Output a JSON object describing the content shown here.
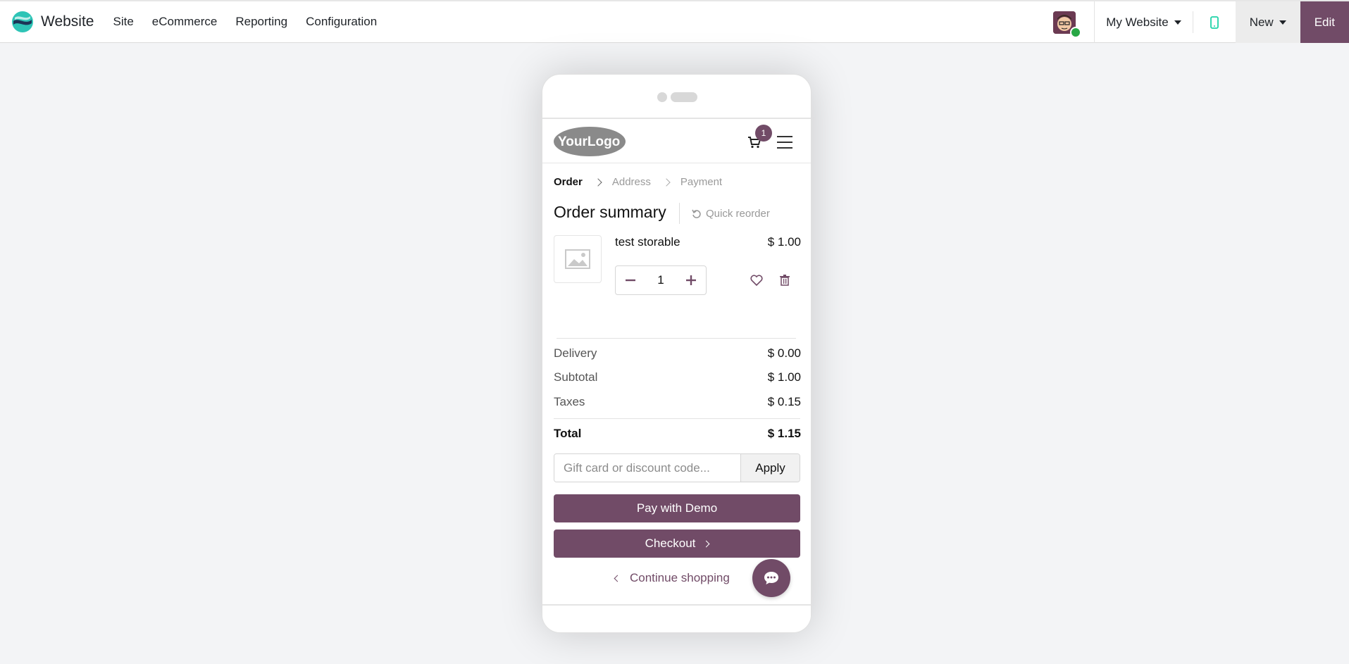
{
  "app": {
    "name": "Website",
    "menu": [
      "Site",
      "eCommerce",
      "Reporting",
      "Configuration"
    ],
    "website_selector": "My Website",
    "new_label": "New",
    "edit_label": "Edit"
  },
  "colors": {
    "brand": "#714b67",
    "mobile_icon": "#1fd3a8",
    "status_online": "#28a745"
  },
  "shop": {
    "logo_text": "YourLogo",
    "cart_count": "1",
    "steps": [
      {
        "label": "Order",
        "active": true
      },
      {
        "label": "Address",
        "active": false
      },
      {
        "label": "Payment",
        "active": false
      }
    ],
    "summary_title": "Order summary",
    "quick_reorder": "Quick reorder",
    "line": {
      "product": "test storable",
      "price": "$ 1.00",
      "quantity": "1"
    },
    "totals": {
      "delivery_label": "Delivery",
      "delivery_value": "$ 0.00",
      "subtotal_label": "Subtotal",
      "subtotal_value": "$ 1.00",
      "taxes_label": "Taxes",
      "taxes_value": "$ 0.15",
      "total_label": "Total",
      "total_value": "$ 1.15"
    },
    "coupon_placeholder": "Gift card or discount code...",
    "apply_label": "Apply",
    "pay_button": "Pay with Demo",
    "checkout_button": "Checkout",
    "continue_label": "Continue shopping"
  }
}
